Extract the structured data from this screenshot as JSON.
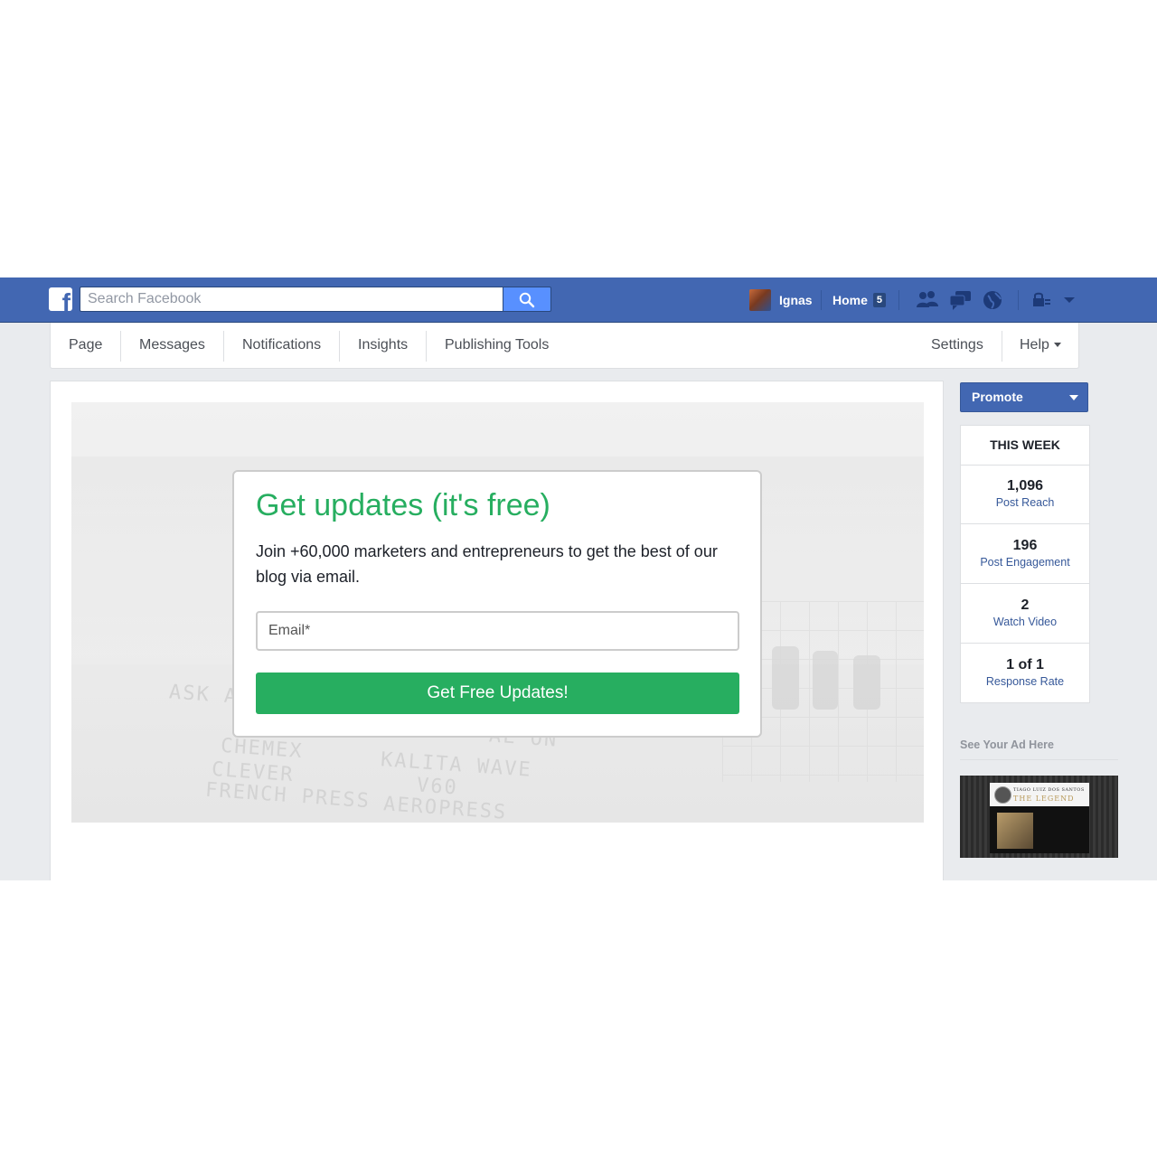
{
  "header": {
    "search_placeholder": "Search Facebook",
    "user_name": "Ignas",
    "home_label": "Home",
    "home_count": "5",
    "icons": [
      "facebook-logo-icon",
      "search-icon",
      "friend-requests-icon",
      "messages-icon",
      "notifications-globe-icon",
      "privacy-lock-icon",
      "account-menu-caret-icon"
    ]
  },
  "pagenav": {
    "items": [
      "Page",
      "Messages",
      "Notifications",
      "Insights",
      "Publishing Tools"
    ],
    "settings": "Settings",
    "help": "Help"
  },
  "optin": {
    "title": "Get updates (it's free)",
    "body": "Join +60,000 marketers and entrepreneurs to get the best of our blog via email.",
    "email_placeholder": "Email*",
    "cta": "Get Free Updates!"
  },
  "hero_text": {
    "line1": "ASK A",
    "line2": "CHEMEX",
    "line3": "CLEVER",
    "line4": "FRENCH PRESS",
    "line5": "KALITA WAVE",
    "line6": "V60",
    "line7": "AEROPRESS",
    "line8": "AL ON"
  },
  "sidebar": {
    "promote": "Promote",
    "this_week": "THIS WEEK",
    "stats": [
      {
        "value": "1,096",
        "label": "Post Reach"
      },
      {
        "value": "196",
        "label": "Post Engagement"
      },
      {
        "value": "2",
        "label": "Watch Video"
      },
      {
        "value": "1 of 1",
        "label": "Response Rate"
      }
    ],
    "ad_title": "See Your Ad Here",
    "ad_name": "TIAGO LUIZ DOS SANTOS",
    "ad_legend": "THE LEGEND"
  },
  "colors": {
    "brand_blue": "#4267b2",
    "cta_green": "#27ae60",
    "link_blue": "#365899"
  }
}
